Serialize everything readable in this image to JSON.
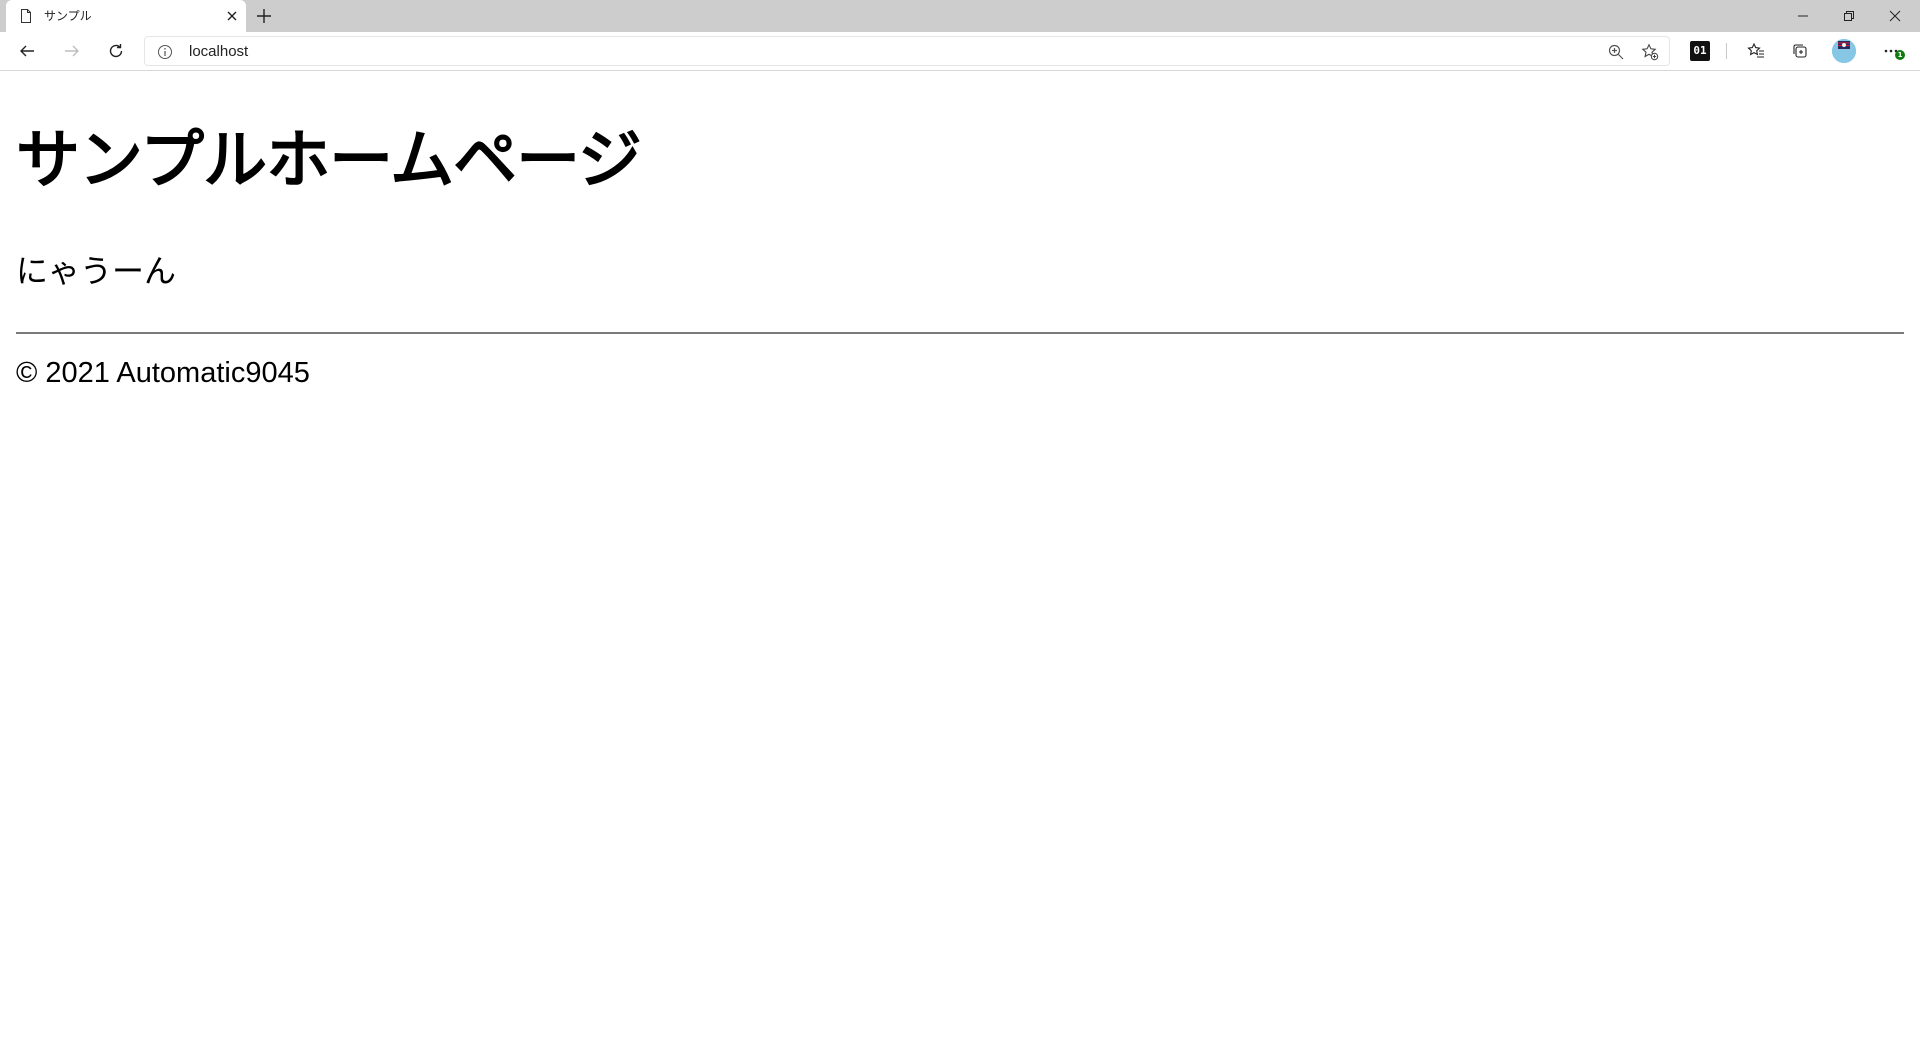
{
  "browser": {
    "tab": {
      "title": "サンプル"
    },
    "address_bar": {
      "url": "localhost"
    },
    "extension_label": "01",
    "notification_badge": "1"
  },
  "page": {
    "heading": "サンプルホームページ",
    "text": "にゃうーん",
    "footer": "© 2021 Automatic9045"
  }
}
